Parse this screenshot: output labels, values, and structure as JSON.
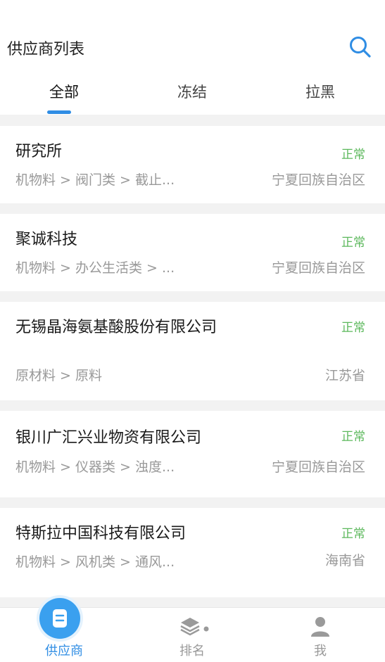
{
  "header": {
    "title": "供应商列表",
    "search_icon": "search-icon"
  },
  "tabs": [
    {
      "label": "全部",
      "active": true
    },
    {
      "label": "冻结",
      "active": false
    },
    {
      "label": "拉黑",
      "active": false
    }
  ],
  "suppliers": [
    {
      "name": "研究所",
      "status": "正常",
      "category": "机物料 > 阀门类 > 截止...",
      "region": "宁夏回族自治区"
    },
    {
      "name": "聚诚科技",
      "status": "正常",
      "category": "机物料 > 办公生活类 > ...",
      "region": "宁夏回族自治区"
    },
    {
      "name": "无锡晶海氨基酸股份有限公司",
      "status": "正常",
      "category": "原材料 > 原料",
      "region": "江苏省"
    },
    {
      "name": "银川广汇兴业物资有限公司",
      "status": "正常",
      "category": "机物料 > 仪器类 > 浊度...",
      "region": "宁夏回族自治区"
    },
    {
      "name": "特斯拉中国科技有限公司",
      "status": "正常",
      "category": "机物料 > 风机类 > 通风...",
      "region": "海南省"
    }
  ],
  "bottom_nav": [
    {
      "label": "供应商",
      "icon": "document-icon",
      "active": true
    },
    {
      "label": "排名",
      "icon": "layers-icon",
      "active": false
    },
    {
      "label": "我",
      "icon": "user-icon",
      "active": false
    }
  ],
  "colors": {
    "accent": "#2f8de4",
    "status_normal": "#5cb85c",
    "secondary_text": "#999999"
  }
}
